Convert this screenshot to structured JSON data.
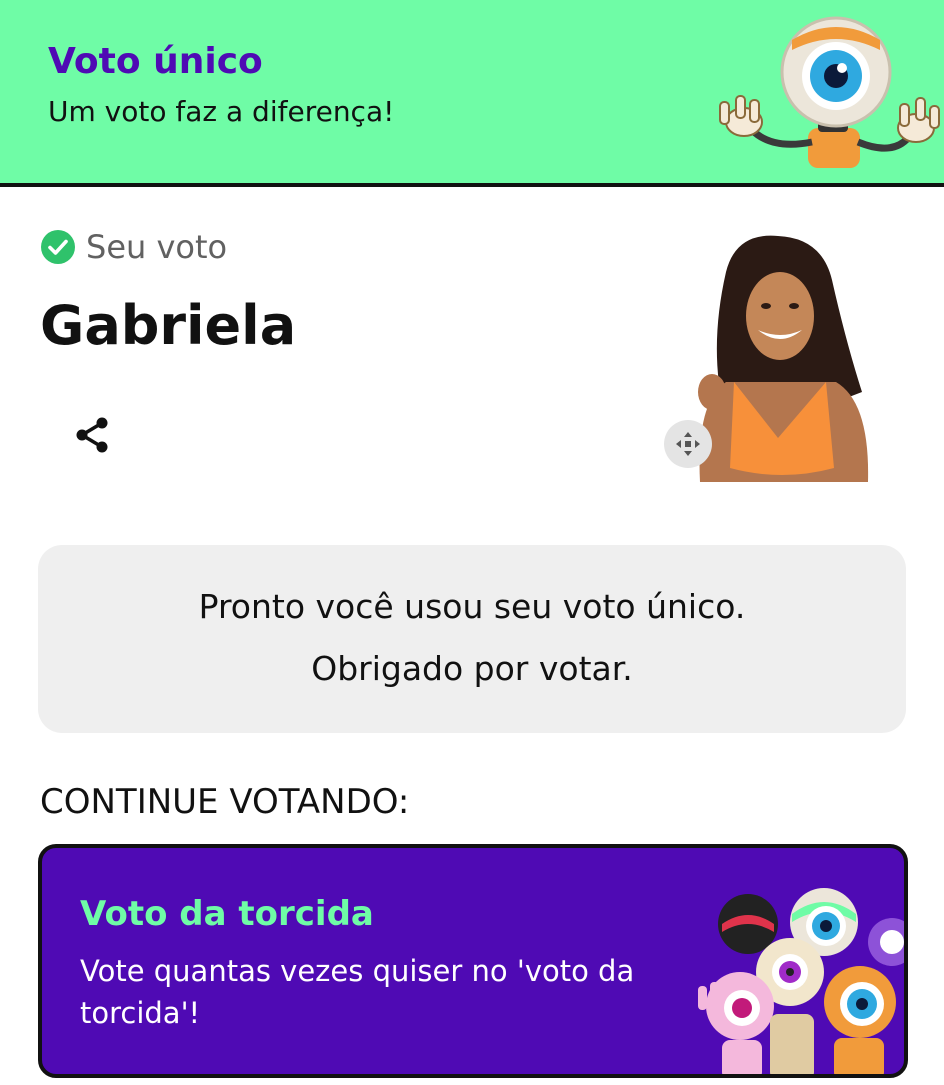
{
  "banner": {
    "title": "Voto único",
    "subtitle": "Um voto faz a diferença!",
    "bg_color": "#6ffca6",
    "title_color": "#4f0ab4"
  },
  "vote": {
    "status_label": "Seu voto",
    "candidate_name": "Gabriela",
    "status_icon": "check-circle-icon",
    "share_icon": "share-icon",
    "photo_icon": "move-arrows-icon"
  },
  "confirmation": {
    "line1": "Pronto você usou seu voto único.",
    "line2": "Obrigado por votar."
  },
  "continue": {
    "label": "CONTINUE VOTANDO:"
  },
  "cta": {
    "title": "Voto da torcida",
    "subtitle": "Vote quantas vezes quiser no 'voto da torcida'!",
    "bg_color": "#4f0ab4",
    "title_color": "#6ffca6"
  }
}
